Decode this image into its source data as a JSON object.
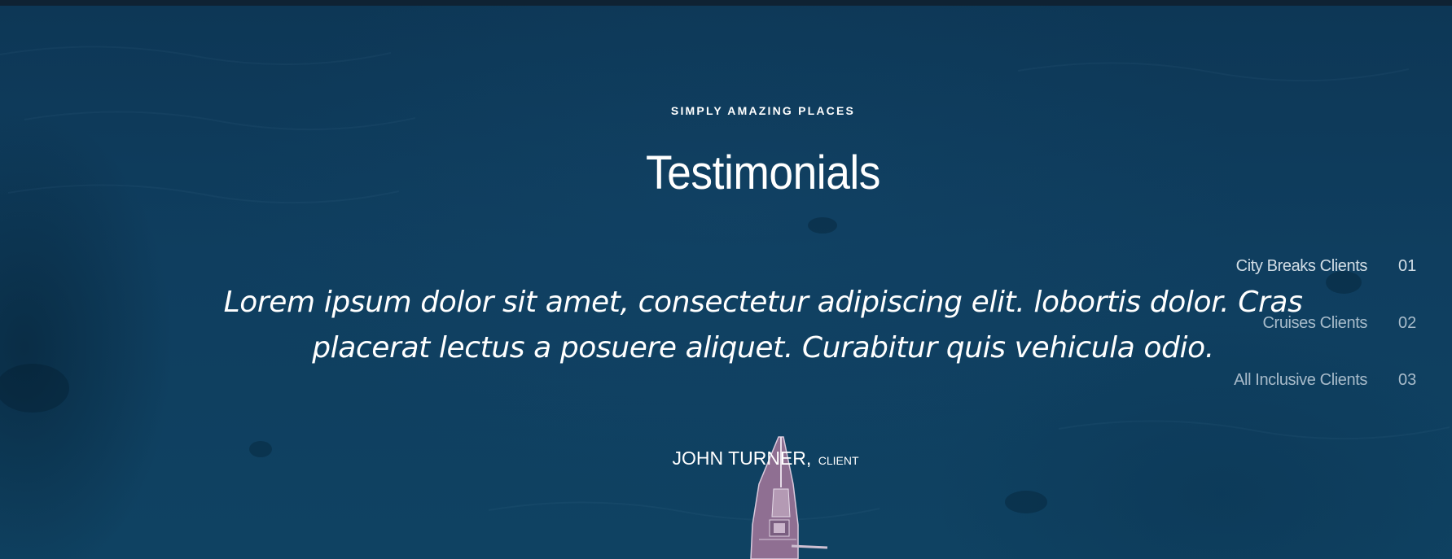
{
  "section": {
    "kicker": "SIMPLY AMAZING PLACES",
    "title": "Testimonials"
  },
  "testimonial": {
    "quote": "Lorem ipsum dolor sit amet, consectetur adipiscing elit. lobortis dolor. Cras placerat lectus a posuere aliquet. Curabitur quis vehicula odio.",
    "author_name": "JOHN TURNER,",
    "author_role": "CLIENT"
  },
  "tabs": [
    {
      "label": "City Breaks Clients",
      "number": "01"
    },
    {
      "label": "Cruises Clients",
      "number": "02"
    },
    {
      "label": "All Inclusive Clients",
      "number": "03"
    }
  ],
  "colors": {
    "background": "#0e3a58",
    "topbar": "#0f2233",
    "text": "#ffffff",
    "tab_text": "#c8d6e2",
    "boat": "#9e7a9a"
  }
}
